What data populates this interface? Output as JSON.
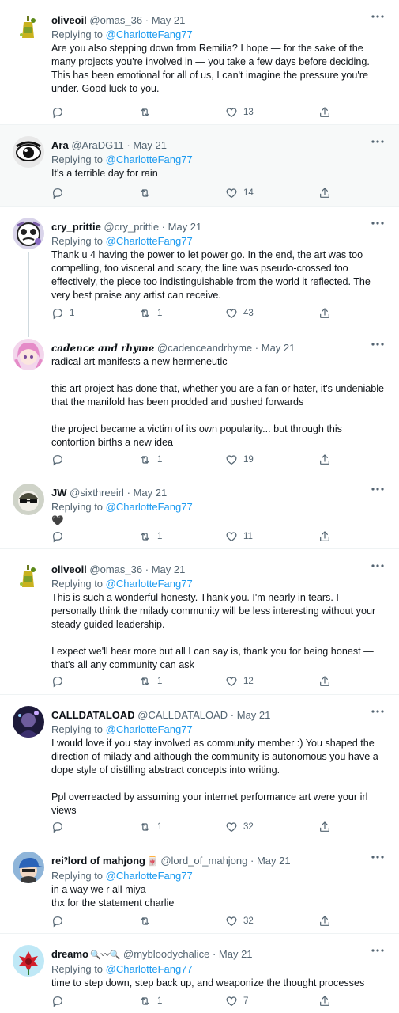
{
  "colors": {
    "accent": "#1d9bf0",
    "muted": "#536471",
    "text": "#0f1419",
    "thread_line": "#cfd9de"
  },
  "tweets": [
    {
      "name": "oliveoil",
      "handle": "@omas_36",
      "sep": "·",
      "date": "May 21",
      "replying_prefix": "Replying to",
      "replying_to": "@CharlotteFang77",
      "paragraphs": [
        "Are you also stepping down from Remilia? I hope — for the sake of the many projects you're involved in — you take a few days before deciding. This has been emotional for all of us, I can't imagine the pressure you're under. Good luck to you."
      ],
      "replies": "",
      "retweets": "",
      "likes": "13",
      "avatar_icon": "olive-bottle-avatar"
    },
    {
      "name": "Ara",
      "handle": "@AraDG11",
      "sep": "·",
      "date": "May 21",
      "replying_prefix": "Replying to",
      "replying_to": "@CharlotteFang77",
      "paragraphs": [
        "It's a terrible day for rain"
      ],
      "replies": "",
      "retweets": "",
      "likes": "14",
      "avatar_icon": "anime-eye-avatar"
    },
    {
      "name": "cry_prittie",
      "handle": "@cry_prittie",
      "sep": "·",
      "date": "May 21",
      "replying_prefix": "Replying to",
      "replying_to": "@CharlotteFang77",
      "paragraphs": [
        "Thank u 4 having the power to let power go. In the end, the art was too compelling, too visceral and scary, the line was pseudo-crossed too effectively, the piece too indistinguishable from the world it reflected. The very best praise any artist can receive."
      ],
      "replies": "1",
      "retweets": "1",
      "likes": "43",
      "avatar_icon": "crying-face-avatar"
    },
    {
      "name": "cadence and rhyme",
      "handle": "@cadenceandrhyme",
      "sep": "·",
      "date": "May 21",
      "paragraphs": [
        "radical art manifests a new hermeneutic",
        "this art project has done that, whether you are a fan or hater, it's undeniable that the manifold has been prodded and pushed forwards",
        "the project became a victim of its own popularity... but through this contortion births a new idea"
      ],
      "replies": "",
      "retweets": "1",
      "likes": "19",
      "avatar_icon": "pink-hair-avatar"
    },
    {
      "name": "JW",
      "handle": "@sixthreeirl",
      "sep": "·",
      "date": "May 21",
      "replying_prefix": "Replying to",
      "replying_to": "@CharlotteFang77",
      "paragraphs": [
        "🖤"
      ],
      "replies": "",
      "retweets": "1",
      "likes": "11",
      "avatar_icon": "sunglasses-avatar"
    },
    {
      "name": "oliveoil",
      "handle": "@omas_36",
      "sep": "·",
      "date": "May 21",
      "replying_prefix": "Replying to",
      "replying_to": "@CharlotteFang77",
      "paragraphs": [
        "This is such a wonderful honesty. Thank you. I'm nearly in tears. I personally think the milady community will be less interesting without your steady guided leadership.",
        "I expect we'll hear more but all I can say is, thank you for being honest — that's all any community can ask"
      ],
      "replies": "",
      "retweets": "1",
      "likes": "12",
      "avatar_icon": "olive-bottle-avatar"
    },
    {
      "name": "CALLDATALOAD",
      "handle": "@CALLDATALOAD",
      "sep": "·",
      "date": "May 21",
      "replying_prefix": "Replying to",
      "replying_to": "@CharlotteFang77",
      "paragraphs": [
        "I would love if you stay involved as community member :) You shaped the direction of milady and although the community is autonomous you have a dope style of distilling abstract concepts into writing.",
        "Ppl overreacted by assuming your internet performance art were your irl views"
      ],
      "replies": "",
      "retweets": "1",
      "likes": "32",
      "avatar_icon": "dark-portrait-avatar"
    },
    {
      "name": "reiˀlord of mahjong",
      "name_emoji": "🀄",
      "handle": "@lord_of_mahjong",
      "sep": "·",
      "date": "May 21",
      "replying_prefix": "Replying to",
      "replying_to": "@CharlotteFang77",
      "paragraphs": [
        "in a way we r all miya\nthx for the statement charlie"
      ],
      "replies": "",
      "retweets": "",
      "likes": "32",
      "avatar_icon": "blue-cap-avatar"
    },
    {
      "name": "dreamo",
      "name_emoji": "🔍〰🔍",
      "handle": "@mybloodychalice",
      "sep": "·",
      "date": "May 21",
      "replying_prefix": "Replying to",
      "replying_to": "@CharlotteFang77",
      "paragraphs": [
        "time to step down, step back up, and weaponize the thought processes"
      ],
      "replies": "",
      "retweets": "1",
      "likes": "7",
      "avatar_icon": "red-flower-avatar"
    }
  ]
}
